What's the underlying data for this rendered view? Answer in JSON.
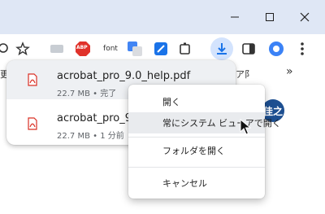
{
  "window": {
    "minimize_icon": "minimize-icon",
    "maximize_icon": "maximize-icon",
    "close_icon": "close-icon"
  },
  "toolbar": {
    "font_ext_label": "font",
    "abp_label": "ABP"
  },
  "bookmarks": {
    "left_fragment": "更",
    "right_fragment": "ア阝",
    "overflow_label": "»"
  },
  "downloads": {
    "items": [
      {
        "name": "acrobat_pro_9.0_help.pdf",
        "meta": "22.7 MB • 完了"
      },
      {
        "name": "acrobat_pro_9.0_he",
        "meta": "22.7 MB • 1 分前"
      }
    ]
  },
  "profile": {
    "avatar_text": "佳之"
  },
  "context_menu": {
    "items": [
      {
        "label": "開く"
      },
      {
        "label": "常にシステム ビューアで開く"
      },
      {
        "label": "フォルダを開く"
      },
      {
        "label": "キャンセル"
      }
    ]
  },
  "colors": {
    "title_bg": "#dfe7f5",
    "accent": "#1a73e8",
    "pdf_red": "#d93025",
    "avatar_bg": "#1d4f91"
  }
}
